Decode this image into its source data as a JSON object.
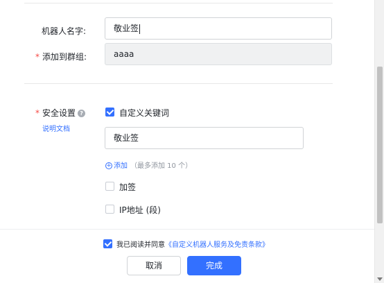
{
  "form": {
    "robot_name_label": "机器人名字:",
    "robot_name_value": "敬业签",
    "group_label": "添加到群组:",
    "group_value": "aaaa",
    "security_label": "安全设置",
    "help_icon_glyph": "?",
    "doc_link": "说明文档",
    "keyword_option": "自定义关键词",
    "keyword_checked": true,
    "keyword_value": "敬业签",
    "add_label": "添加",
    "add_hint": "（最多添加 10 个）",
    "sign_option": "加签",
    "sign_checked": false,
    "ip_option": "IP地址 (段)",
    "ip_checked": false
  },
  "footer": {
    "agree_prefix": "我已阅读并同意",
    "agree_link": "《自定义机器人服务及免责条款》",
    "agree_checked": true,
    "cancel_label": "取消",
    "confirm_label": "完成"
  },
  "colors": {
    "accent": "#3370ff",
    "required": "#f54a45"
  }
}
